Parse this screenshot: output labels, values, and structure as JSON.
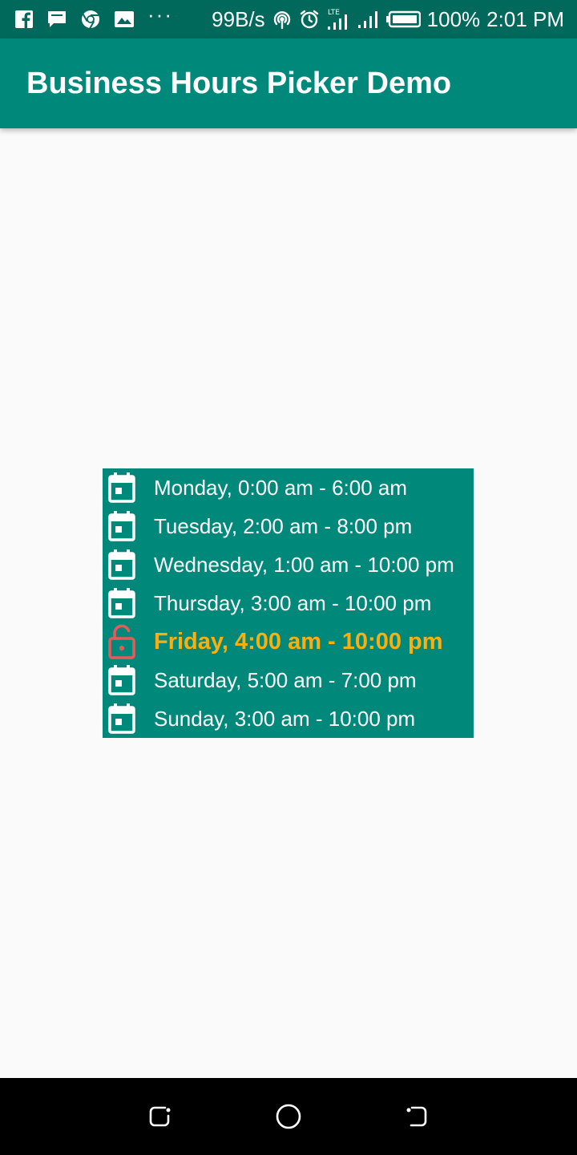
{
  "status_bar": {
    "net_speed": "99B/s",
    "battery": "100%",
    "time": "2:01 PM",
    "lte_label": "LTE",
    "icons": [
      "facebook-icon",
      "message-icon",
      "chrome-icon",
      "gallery-icon",
      "more-dots-icon",
      "hotspot-icon",
      "alarm-icon",
      "signal-lte-icon",
      "signal-icon",
      "battery-icon"
    ],
    "more": "···"
  },
  "app_bar": {
    "title": "Business Hours Picker Demo"
  },
  "hours": [
    {
      "label": "Monday, 0:00 am - 6:00 am",
      "icon": "calendar-icon",
      "active": false
    },
    {
      "label": "Tuesday, 2:00 am - 8:00 pm",
      "icon": "calendar-icon",
      "active": false
    },
    {
      "label": "Wednesday, 1:00 am - 10:00 pm",
      "icon": "calendar-icon",
      "active": false
    },
    {
      "label": "Thursday, 3:00 am - 10:00 pm",
      "icon": "calendar-icon",
      "active": false
    },
    {
      "label": "Friday, 4:00 am - 10:00 pm",
      "icon": "unlock-icon",
      "active": true
    },
    {
      "label": "Saturday, 5:00 am - 7:00 pm",
      "icon": "calendar-icon",
      "active": false
    },
    {
      "label": "Sunday, 3:00 am - 10:00 pm",
      "icon": "calendar-icon",
      "active": false
    }
  ],
  "colors": {
    "status_bar": "#00695c",
    "app_bar": "#00897b",
    "list_bg": "#00897b",
    "active_text": "#f9b00f",
    "active_icon": "#e85a5a",
    "text": "#ffffff",
    "background": "#fafafa"
  },
  "nav_bar": {
    "buttons": [
      "recent-apps-icon",
      "home-icon",
      "back-icon"
    ]
  }
}
